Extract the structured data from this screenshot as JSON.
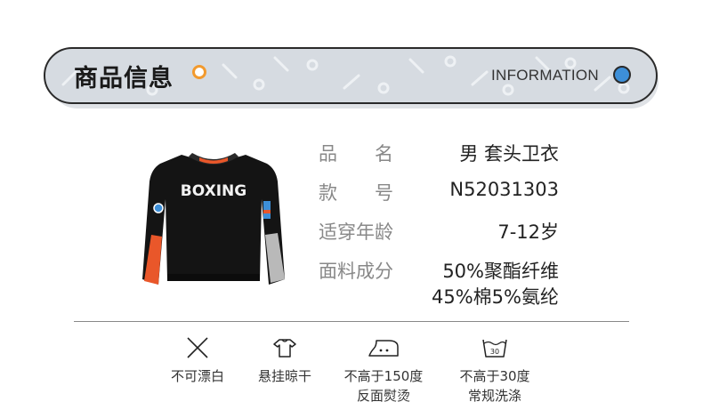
{
  "header": {
    "title_cn": "商品信息",
    "title_en": "INFORMATION",
    "accent_orange": "#f29a2e",
    "accent_blue": "#3d8fd8"
  },
  "product": {
    "image_icon": "black-sweatshirt-image",
    "print_text": "BOXING"
  },
  "specs": [
    {
      "label": "品　　名",
      "value": "男 套头卫衣"
    },
    {
      "label": "款　　号",
      "value": "N52031303"
    },
    {
      "label": "适穿年龄",
      "value": "7-12岁"
    },
    {
      "label": "面料成分",
      "value_line1": "50%聚酯纤维",
      "value_line2": "45%棉5%氨纶"
    }
  ],
  "care": [
    {
      "icon": "no-bleach-icon",
      "line1": "不可漂白",
      "line2": ""
    },
    {
      "icon": "hang-dry-icon",
      "line1": "悬挂晾干",
      "line2": ""
    },
    {
      "icon": "iron-150-icon",
      "line1": "不高于150度",
      "line2": "反面熨烫"
    },
    {
      "icon": "wash-30-icon",
      "line1": "不高于30度",
      "line2": "常规洗涤",
      "temp": "30"
    }
  ]
}
